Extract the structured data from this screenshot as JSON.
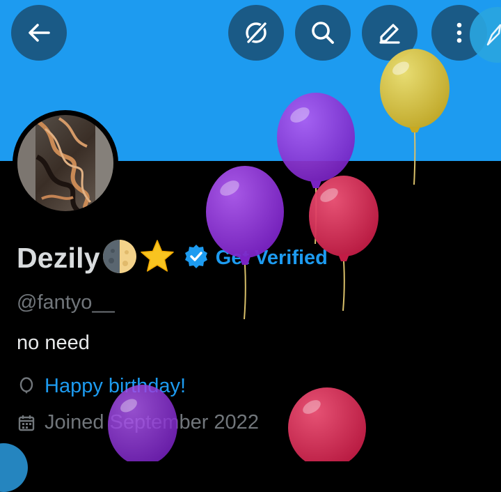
{
  "colors": {
    "banner": "#1d9bf0",
    "accent": "#1d9bf0",
    "muted": "#71767b",
    "text": "#e7e9ea",
    "background": "#000000"
  },
  "toolbar": {
    "back_icon": "arrow-left-icon",
    "grok_icon": "grok-icon",
    "search_icon": "search-icon",
    "edit_icon": "edit-pen-icon",
    "more_icon": "more-vertical-icon"
  },
  "profile": {
    "display_name": "Dezily",
    "name_emojis": [
      "🌗",
      "⭐"
    ],
    "verified_badge": "verified-badge-icon",
    "get_verified_label": "Get Verified",
    "handle": "@fantyo__",
    "bio": "no need",
    "birthday_label": "Happy birthday!",
    "joined_label": "Joined September 2022"
  },
  "balloon_colors": [
    "#e3c53a",
    "#9a3ee0",
    "#9a3ee0",
    "#e23a59",
    "#9a3ee0",
    "#e23a59"
  ]
}
